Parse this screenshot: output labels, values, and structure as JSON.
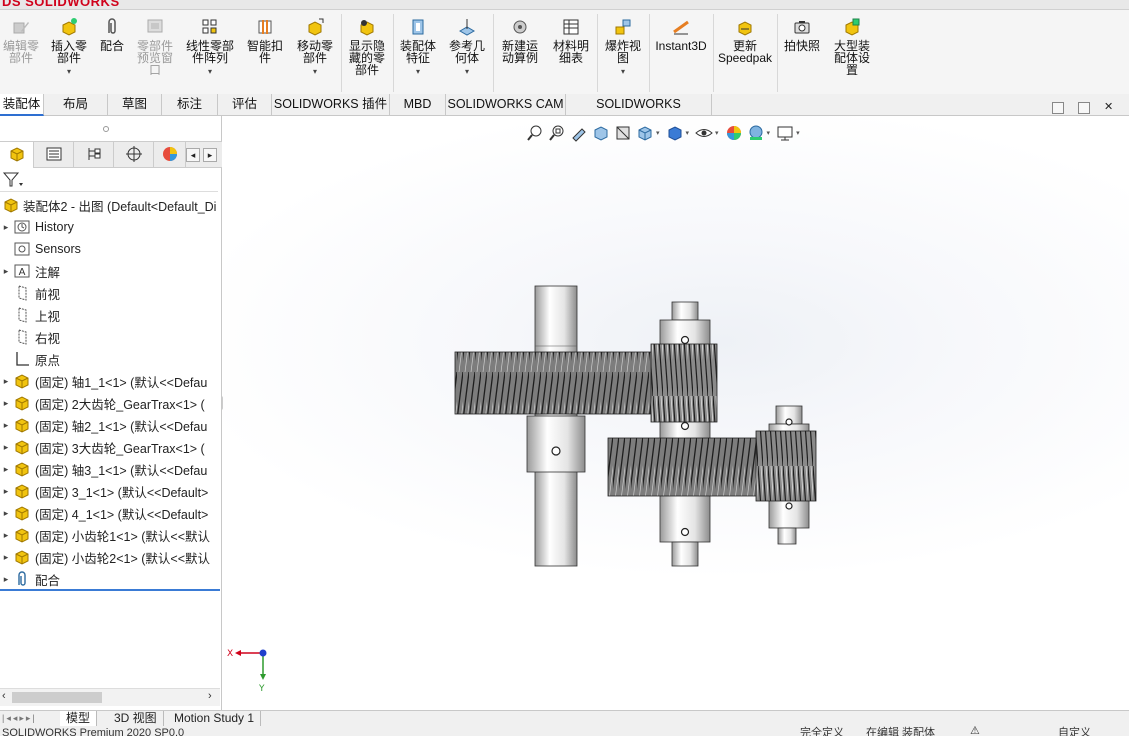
{
  "app": {
    "logo_ds": "DS",
    "logo_name": "SOLIDWORKS"
  },
  "toolbar": {
    "items": [
      {
        "label": "编辑零\n部件",
        "disabled": true
      },
      {
        "label": "插入零\n部件",
        "disabled": false
      },
      {
        "label": "配合",
        "disabled": false
      },
      {
        "label": "零部件\n预览窗\n口",
        "disabled": true
      },
      {
        "label": "线性零部\n件阵列",
        "disabled": false
      },
      {
        "label": "智能扣\n件",
        "disabled": false
      },
      {
        "label": "移动零\n部件",
        "disabled": false
      },
      {
        "label": "显示隐\n藏的零\n部件",
        "disabled": false
      },
      {
        "label": "装配体\n特征",
        "disabled": false
      },
      {
        "label": "参考几\n何体",
        "disabled": false
      },
      {
        "label": "新建运\n动算例",
        "disabled": false
      },
      {
        "label": "材料明\n细表",
        "disabled": false
      },
      {
        "label": "爆炸视\n图",
        "disabled": false
      },
      {
        "label": "Instant3D",
        "disabled": false
      },
      {
        "label": "更新\nSpeedpak",
        "disabled": false
      },
      {
        "label": "拍快照",
        "disabled": false
      },
      {
        "label": "大型装\n配体设\n置",
        "disabled": false
      }
    ]
  },
  "tabs": [
    "装配体",
    "布局",
    "草图",
    "标注",
    "评估",
    "SOLIDWORKS 插件",
    "MBD",
    "SOLIDWORKS CAM",
    "SOLIDWORKS Inspection"
  ],
  "tree": {
    "root": "装配体2 - 出图  (Default<Default_Di",
    "nodes": [
      "History",
      "Sensors",
      "注解",
      "前视",
      "上视",
      "右视",
      "原点",
      "(固定) 轴1_1<1> (默认<<Defau",
      "(固定) 2大齿轮_GearTrax<1> (",
      "(固定) 轴2_1<1> (默认<<Defau",
      "(固定) 3大齿轮_GearTrax<1> (",
      "(固定) 轴3_1<1> (默认<<Defau",
      "(固定) 3_1<1> (默认<<Default>",
      "(固定) 4_1<1> (默认<<Default>",
      "(固定) 小齿轮1<1> (默认<<默认",
      "(固定) 小齿轮2<1> (默认<<默认",
      "配合"
    ]
  },
  "triad": {
    "x_label": "X",
    "y_label": "Y"
  },
  "bottom_tabs": [
    "模型",
    "3D 视图",
    "Motion Study 1"
  ],
  "status": {
    "left": "SOLIDWORKS Premium 2020 SP0.0",
    "right1": "完全定义",
    "right2": "在编辑 装配体",
    "right3": "自定义"
  },
  "colors": {
    "accent": "#2e6fd1",
    "logo": "#d0021b",
    "part_yellow": "#e8b400"
  }
}
